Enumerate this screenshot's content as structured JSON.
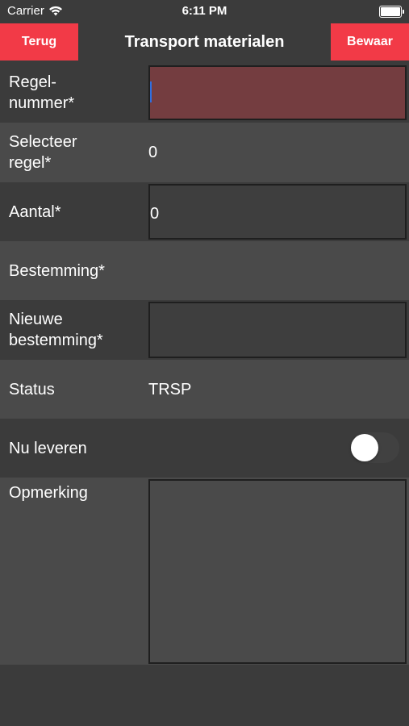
{
  "status_bar": {
    "carrier": "Carrier",
    "time": "6:11 PM",
    "wifi_icon": "wifi-icon",
    "battery_icon": "battery-icon"
  },
  "nav": {
    "back_label": "Terug",
    "title": "Transport materialen",
    "save_label": "Bewaar"
  },
  "form": {
    "regelnummer": {
      "label": "Regel-\nnummer*",
      "value": ""
    },
    "selecteer_regel": {
      "label": "Selecteer\nregel*",
      "value": "0"
    },
    "aantal": {
      "label": "Aantal*",
      "value": "0"
    },
    "bestemming": {
      "label": "Bestemming*",
      "value": ""
    },
    "nieuwe_bestemming": {
      "label": "Nieuwe\nbestemming*",
      "value": ""
    },
    "status": {
      "label": "Status",
      "value": "TRSP"
    },
    "nu_leveren": {
      "label": "Nu leveren",
      "on": false
    },
    "opmerking": {
      "label": "Opmerking",
      "value": ""
    }
  },
  "colors": {
    "accent": "#f23a47",
    "background": "#3b3b3b",
    "row_alt": "#4a4a4a",
    "error_field": "#743d40",
    "text": "#ffffff"
  }
}
